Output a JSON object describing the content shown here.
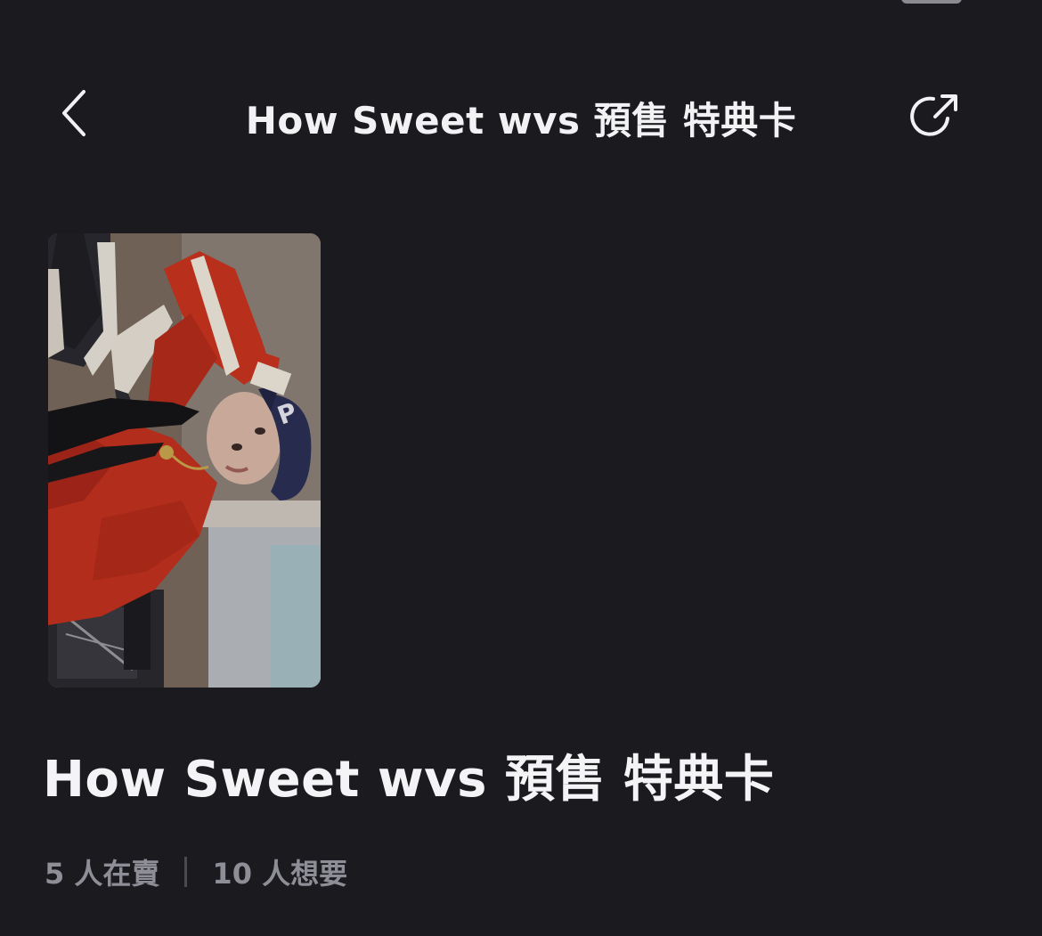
{
  "nav": {
    "title": "How Sweet wvs 預售 特典卡",
    "back_icon": "chevron-left-icon",
    "share_icon": "share-external-icon"
  },
  "card": {
    "image_alt": "photocard"
  },
  "item": {
    "title": "How Sweet wvs 預售 特典卡",
    "sellers": "5 人在賣",
    "wanters": "10 人想要"
  },
  "colors": {
    "background": "#1b1b1f",
    "text_primary": "#f2f2f4",
    "text_secondary": "#8e8e96"
  }
}
